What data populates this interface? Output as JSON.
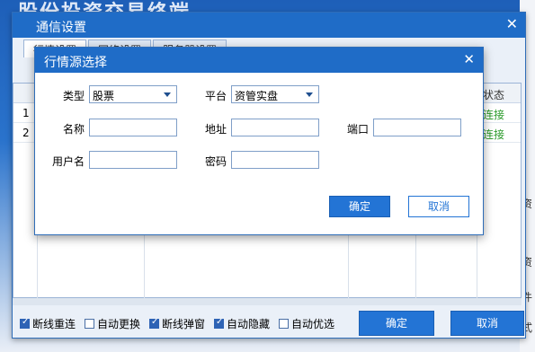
{
  "background": {
    "app_title": "股份投资交易终端",
    "right_side_fragments": [
      "资",
      "资",
      "件",
      "式"
    ]
  },
  "main_dialog": {
    "title": "通信设置",
    "tabs": [
      "行情设置",
      "网络设置",
      "服务器设置"
    ],
    "grid": {
      "status_header": "状态",
      "rows": [
        {
          "num": "1",
          "status": "连接"
        },
        {
          "num": "2",
          "status": "连接"
        }
      ]
    },
    "options": [
      {
        "label": "断线重连",
        "checked": true
      },
      {
        "label": "自动更换",
        "checked": false
      },
      {
        "label": "断线弹窗",
        "checked": true
      },
      {
        "label": "自动隐藏",
        "checked": true
      },
      {
        "label": "自动优选",
        "checked": false
      }
    ],
    "confirm_label": "确定",
    "cancel_label": "取消"
  },
  "modal": {
    "title": "行情源选择",
    "type_label": "类型",
    "type_value": "股票",
    "platform_label": "平台",
    "platform_value": "资管实盘",
    "name_label": "名称",
    "address_label": "地址",
    "port_label": "端口",
    "username_label": "用户名",
    "password_label": "密码",
    "confirm_label": "确定",
    "cancel_label": "取消"
  }
}
